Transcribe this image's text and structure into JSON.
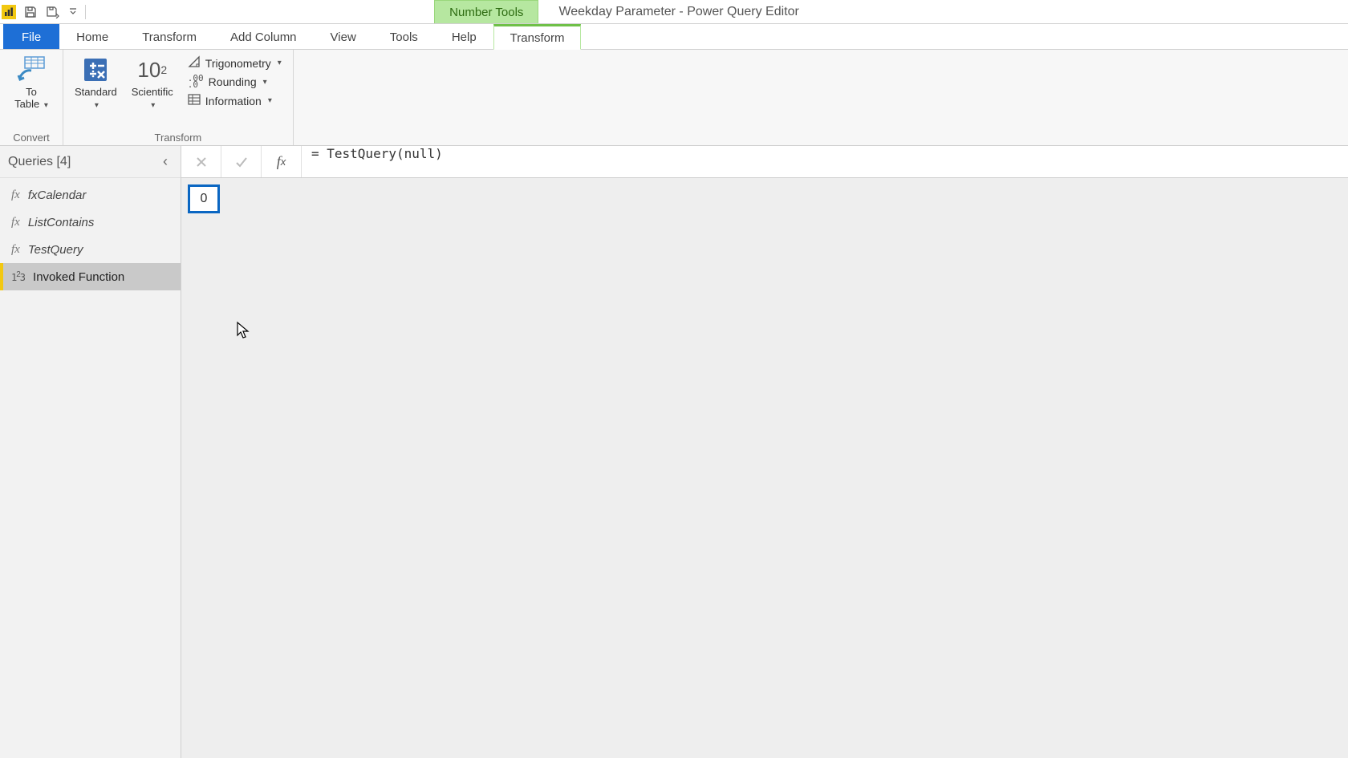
{
  "titlebar": {
    "context_tool_label": "Number Tools",
    "window_title": "Weekday Parameter - Power Query Editor"
  },
  "tabs": {
    "file": "File",
    "home": "Home",
    "transform": "Transform",
    "add_column": "Add Column",
    "view": "View",
    "tools": "Tools",
    "help": "Help",
    "ctx_transform": "Transform"
  },
  "ribbon": {
    "convert": {
      "to_table": "To\nTable",
      "group_label": "Convert"
    },
    "transform": {
      "standard": "Standard",
      "scientific": "Scientific",
      "trigonometry": "Trigonometry",
      "rounding": "Rounding",
      "information": "Information",
      "group_label": "Transform"
    }
  },
  "queries": {
    "header": "Queries [4]",
    "items": [
      {
        "icon": "fx",
        "label": "fxCalendar"
      },
      {
        "icon": "fx",
        "label": "ListContains"
      },
      {
        "icon": "fx",
        "label": "TestQuery"
      },
      {
        "icon": "123",
        "label": "Invoked Function"
      }
    ],
    "selected_index": 3
  },
  "formula_bar": {
    "text": "= TestQuery(null)"
  },
  "result": {
    "value": "0"
  }
}
